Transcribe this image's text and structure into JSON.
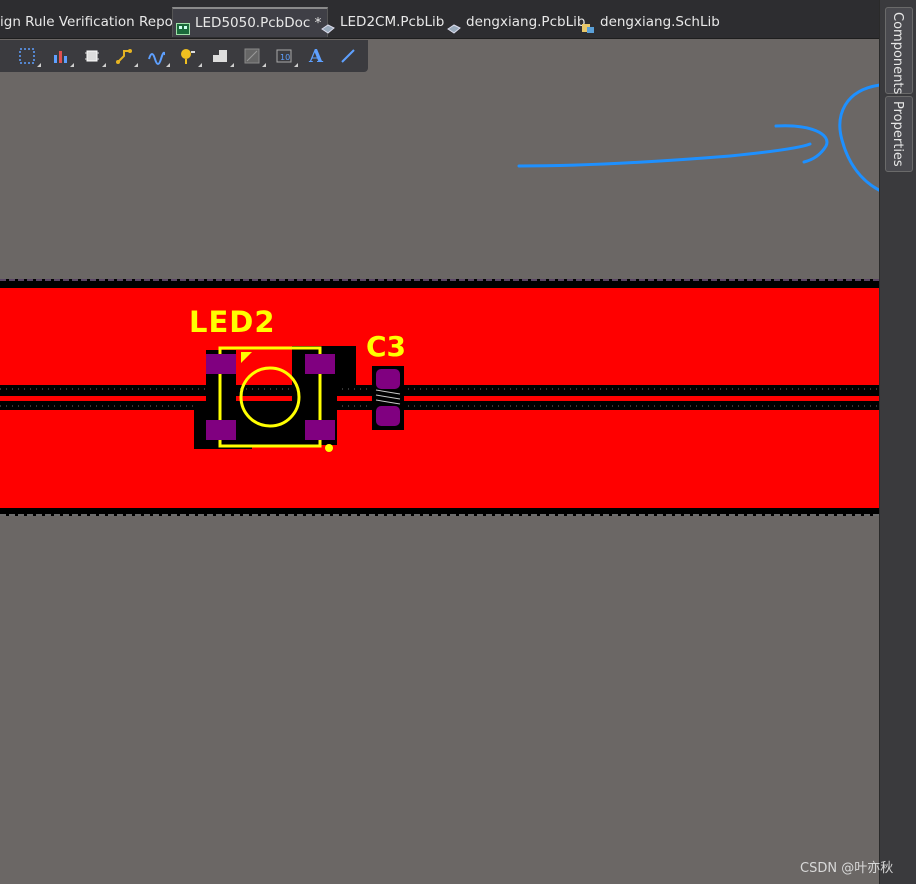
{
  "tabs": [
    {
      "label": "ign Rule Verification Report",
      "icon": "none"
    },
    {
      "label": "LED5050.PcbDoc *",
      "icon": "pcb-doc-icon",
      "active": true
    },
    {
      "label": "LED2CM.PcbLib",
      "icon": "pcb-lib-icon"
    },
    {
      "label": "dengxiang.PcbLib",
      "icon": "pcb-lib-icon"
    },
    {
      "label": "dengxiang.SchLib",
      "icon": "sch-lib-icon"
    }
  ],
  "toolbar": {
    "tools": [
      "select-rect-icon",
      "chart-icon",
      "component-icon",
      "route-icon",
      "interactive-tune-icon",
      "via-probe-icon",
      "fill-icon",
      "region-icon",
      "dimension-icon",
      "text-tool-icon",
      "line-tool-icon"
    ],
    "text_tool_glyph": "A"
  },
  "side_panels": {
    "components": "Components",
    "properties": "Properties"
  },
  "designators": {
    "led": "LED2",
    "cap": "C3"
  },
  "colors": {
    "board_bg": "#6b6765",
    "copper_top": "#ff0000",
    "silkscreen": "#ffff00",
    "pad": "#800080",
    "annotation": "#1e90ff"
  },
  "watermark": "CSDN @叶亦秋"
}
